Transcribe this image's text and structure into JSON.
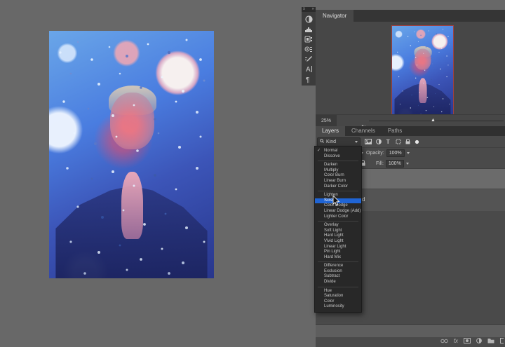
{
  "colors": {
    "canvas_bg": "#686868",
    "panel_bg": "#4a4a4a",
    "menu_bg": "#282828",
    "highlight_blue": "#1f64d4",
    "selected_row_gray": "#6b6b6b",
    "navigator_proxy_border": "#a04040"
  },
  "dock": {
    "close_glyph": "x",
    "expand_glyph": "»",
    "icons": [
      "adjustments-icon",
      "histogram-icon",
      "brush-settings-icon",
      "clone-source-icon",
      "brush-tool-icon",
      "character-panel-icon",
      "paragraph-panel-icon"
    ]
  },
  "navigator": {
    "tab_label": "Navigator",
    "zoom_value": "25%",
    "slider_thumb_glyph": "▲"
  },
  "layers_panel": {
    "tabs": [
      "Layers",
      "Channels",
      "Paths"
    ],
    "filter_label": "Kind",
    "filter_icons": [
      "search-icon",
      "pixel-layer-filter-icon",
      "adjustment-filter-icon",
      "type-filter-icon",
      "shape-filter-icon",
      "smart-object-filter-icon",
      "filter-toggle-icon"
    ],
    "opacity_label": "Opacity:",
    "opacity_value": "100%",
    "fill_label": "Fill:",
    "fill_value": "100%",
    "layer_name_fragment": "d",
    "bottom_icons": [
      "link-layers-icon",
      "layer-effects-icon",
      "add-mask-icon",
      "adjustment-layer-icon",
      "new-group-icon",
      "new-layer-icon"
    ]
  },
  "blend_menu": {
    "selected": "Normal",
    "hovered": "Screen",
    "check_glyph": "✓",
    "groups": [
      [
        "Normal",
        "Dissolve"
      ],
      [
        "Darken",
        "Multiply",
        "Color Burn",
        "Linear Burn",
        "Darker Color"
      ],
      [
        "Lighten",
        "Screen",
        "Color Dodge",
        "Linear Dodge (Add)",
        "Lighter Color"
      ],
      [
        "Overlay",
        "Soft Light",
        "Hard Light",
        "Vivid Light",
        "Linear Light",
        "Pin Light",
        "Hard Mix"
      ],
      [
        "Difference",
        "Exclusion",
        "Subtract",
        "Divide"
      ],
      [
        "Hue",
        "Saturation",
        "Color",
        "Luminosity"
      ]
    ]
  }
}
